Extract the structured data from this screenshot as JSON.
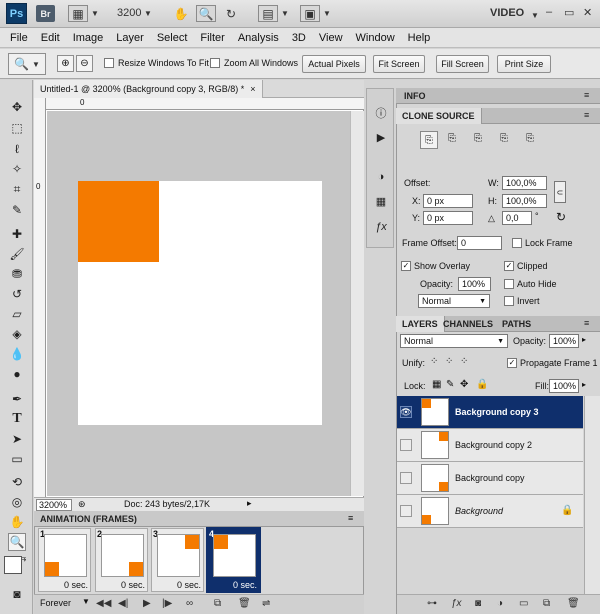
{
  "app": {
    "ps_label": "Ps",
    "br_label": "Br",
    "zoom": "3200",
    "workspace": "VIDEO",
    "win_min": "–",
    "win_restore": "▭",
    "win_close": "✕"
  },
  "menu": [
    "File",
    "Edit",
    "Image",
    "Layer",
    "Select",
    "Filter",
    "Analysis",
    "3D",
    "View",
    "Window",
    "Help"
  ],
  "options": {
    "resize_windows": "Resize Windows To Fit",
    "zoom_all_windows": "Zoom All Windows",
    "actual_pixels": "Actual Pixels",
    "fit_screen": "Fit Screen",
    "fill_screen": "Fill Screen",
    "print_size": "Print Size"
  },
  "document": {
    "tab_title": "Untitled-1 @ 3200% (Background copy 3, RGB/8) *",
    "tab_close": "×",
    "ruler_zero": "0",
    "zoom": "3200%",
    "doc_info": "Doc: 243 bytes/2,17K"
  },
  "animation": {
    "title": "ANIMATION (FRAMES)",
    "loop": "Forever",
    "frames": [
      {
        "num": "1",
        "delay": "0 sec.",
        "orange": "bottom-left"
      },
      {
        "num": "2",
        "delay": "0 sec.",
        "orange": "bottom-right"
      },
      {
        "num": "3",
        "delay": "0 sec.",
        "orange": "top-right"
      },
      {
        "num": "4",
        "delay": "0 sec.",
        "orange": "top-left"
      }
    ]
  },
  "info_panel": {
    "title": "INFO"
  },
  "clone_source": {
    "title": "CLONE SOURCE",
    "offset": "Offset:",
    "x_label": "X:",
    "x_value": "0 px",
    "y_label": "Y:",
    "y_value": "0 px",
    "w_label": "W:",
    "w_value": "100,0%",
    "h_label": "H:",
    "h_value": "100,0%",
    "angle_value": "0,0",
    "degree": "°",
    "frame_offset_label": "Frame Offset:",
    "frame_offset_value": "0",
    "lock_frame": "Lock Frame",
    "show_overlay": "Show Overlay",
    "clipped": "Clipped",
    "opacity_label": "Opacity:",
    "opacity_value": "100%",
    "auto_hide": "Auto Hide",
    "blend_mode": "Normal",
    "invert": "Invert"
  },
  "layers": {
    "tabs": [
      "LAYERS",
      "CHANNELS",
      "PATHS"
    ],
    "blend_mode": "Normal",
    "opacity_label": "Opacity:",
    "opacity_value": "100%",
    "unify_label": "Unify:",
    "propagate": "Propagate Frame 1",
    "lock_label": "Lock:",
    "fill_label": "Fill:",
    "fill_value": "100%",
    "items": [
      {
        "name": "Background copy 3",
        "selected": true,
        "visible": true,
        "orange": "top-left"
      },
      {
        "name": "Background copy 2",
        "selected": false,
        "visible": false,
        "orange": "top-right"
      },
      {
        "name": "Background copy",
        "selected": false,
        "visible": false,
        "orange": "bottom-right"
      },
      {
        "name": "Background",
        "selected": false,
        "visible": false,
        "orange": "bottom-left",
        "locked": true
      }
    ]
  },
  "colors": {
    "accent_orange": "#f47a00",
    "selection": "#0f2f6c"
  }
}
